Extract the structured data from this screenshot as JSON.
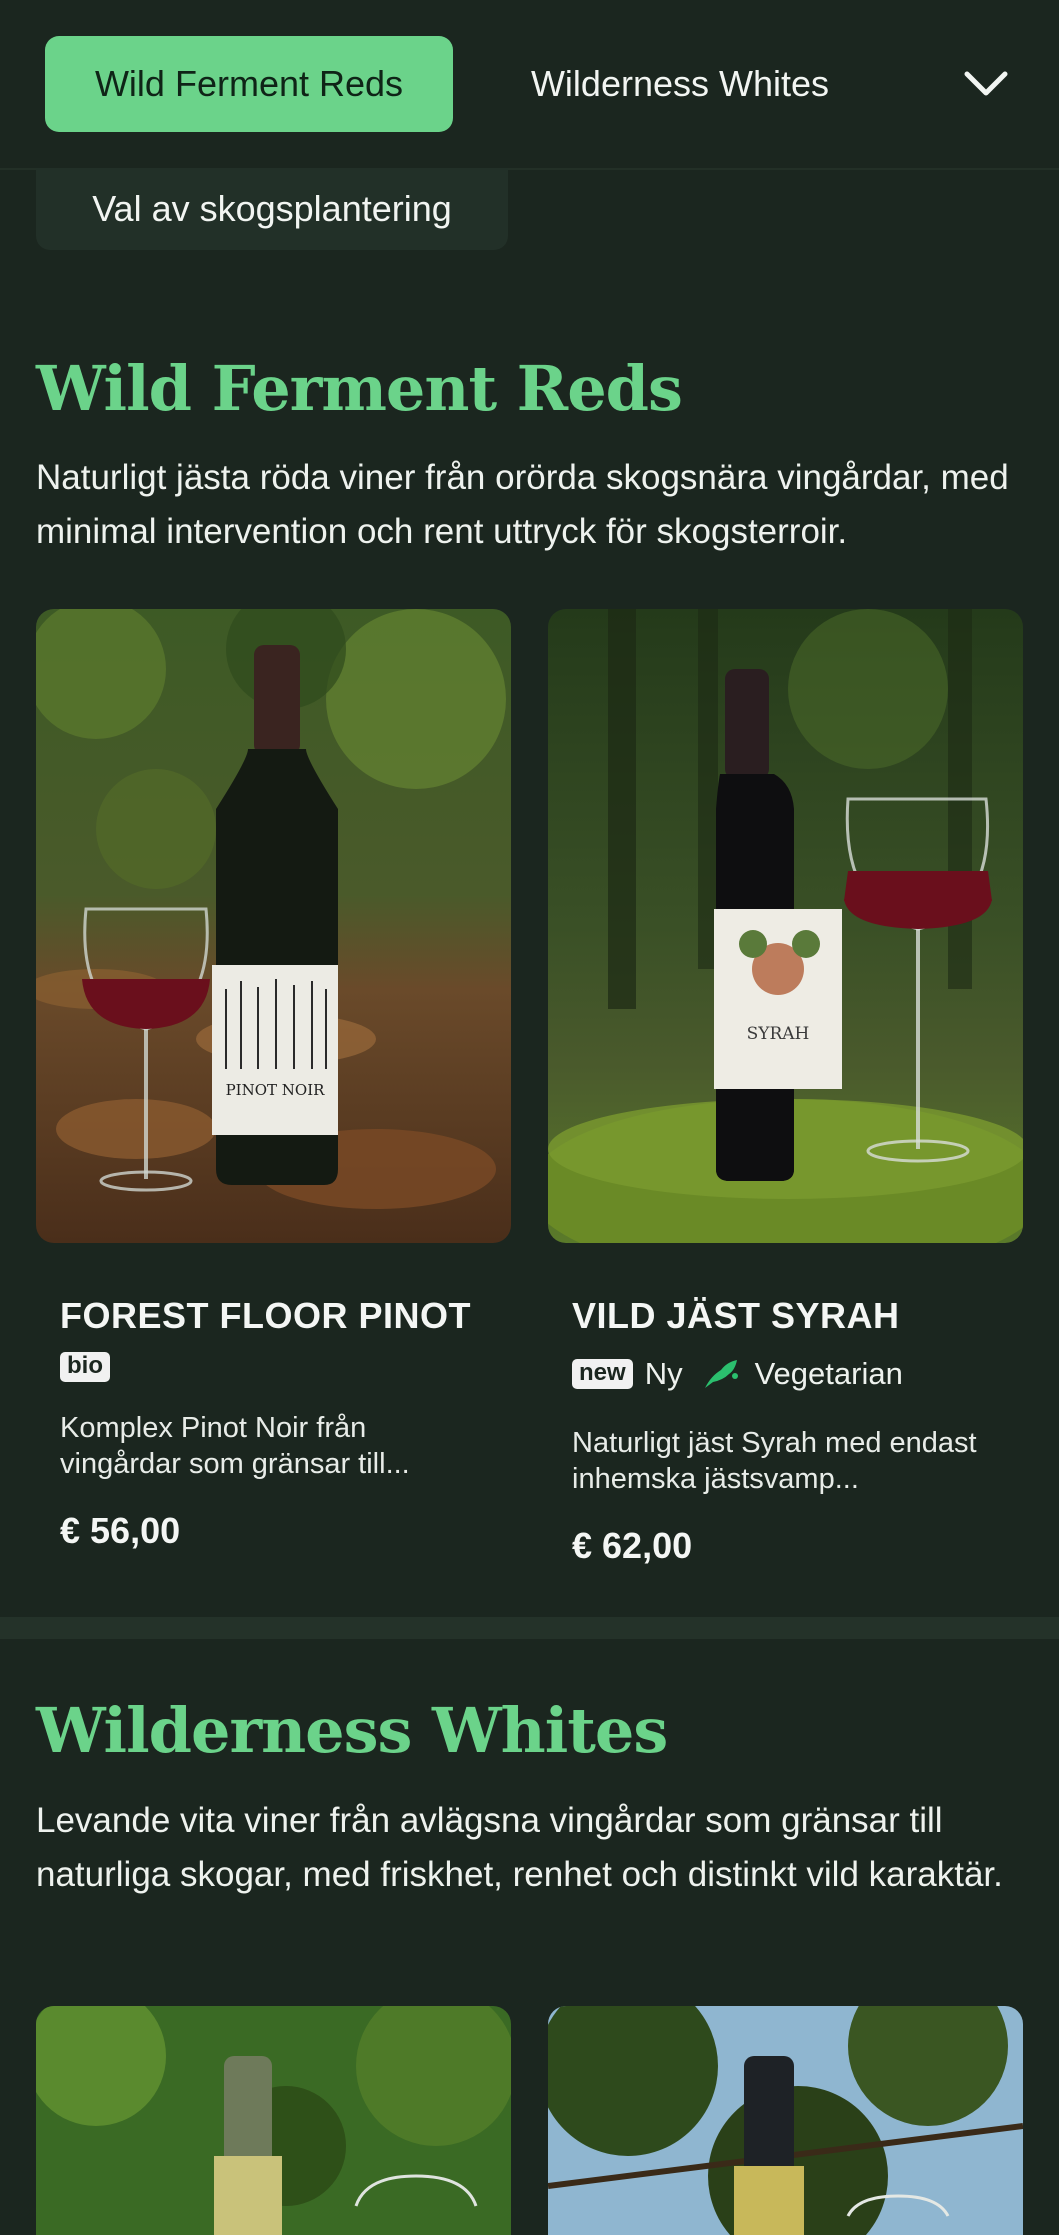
{
  "nav": {
    "tabs": [
      {
        "label": "Wild Ferment Reds",
        "active": true
      },
      {
        "label": "Wilderness Whites",
        "active": false
      }
    ],
    "expand_icon": "chevron-down-icon",
    "sub_tab": "Val av skogsplantering"
  },
  "sections": [
    {
      "title": "Wild Ferment Reds",
      "description": "Naturligt jästa röda viner från orörda skogsnära vingårdar, med minimal intervention och rent uttryck för skogsterroir.",
      "products": [
        {
          "name": "FOREST FLOOR PINOT",
          "badge": "bio",
          "tags": [],
          "description": "Komplex Pinot Noir från vingårdar som gränsar till...",
          "price": "€ 56,00",
          "label_text": "PINOT NOIR"
        },
        {
          "name": "VILD JÄST SYRAH",
          "badge": "new",
          "tags": [
            "Ny",
            "Vegetarian"
          ],
          "description": "Naturligt jäst Syrah med endast inhemska jästsvamp...",
          "price": "€ 62,00",
          "label_text": "SYRAH"
        }
      ]
    },
    {
      "title": "Wilderness Whites",
      "description": "Levande vita viner från avlägsna vingårdar som gränsar till naturliga skogar, med friskhet, renhet och distinkt vild karaktär.",
      "products": []
    }
  ],
  "colors": {
    "background": "#1b261f",
    "accent": "#6bd38a",
    "vegetarian_icon": "#2bbf6e"
  }
}
